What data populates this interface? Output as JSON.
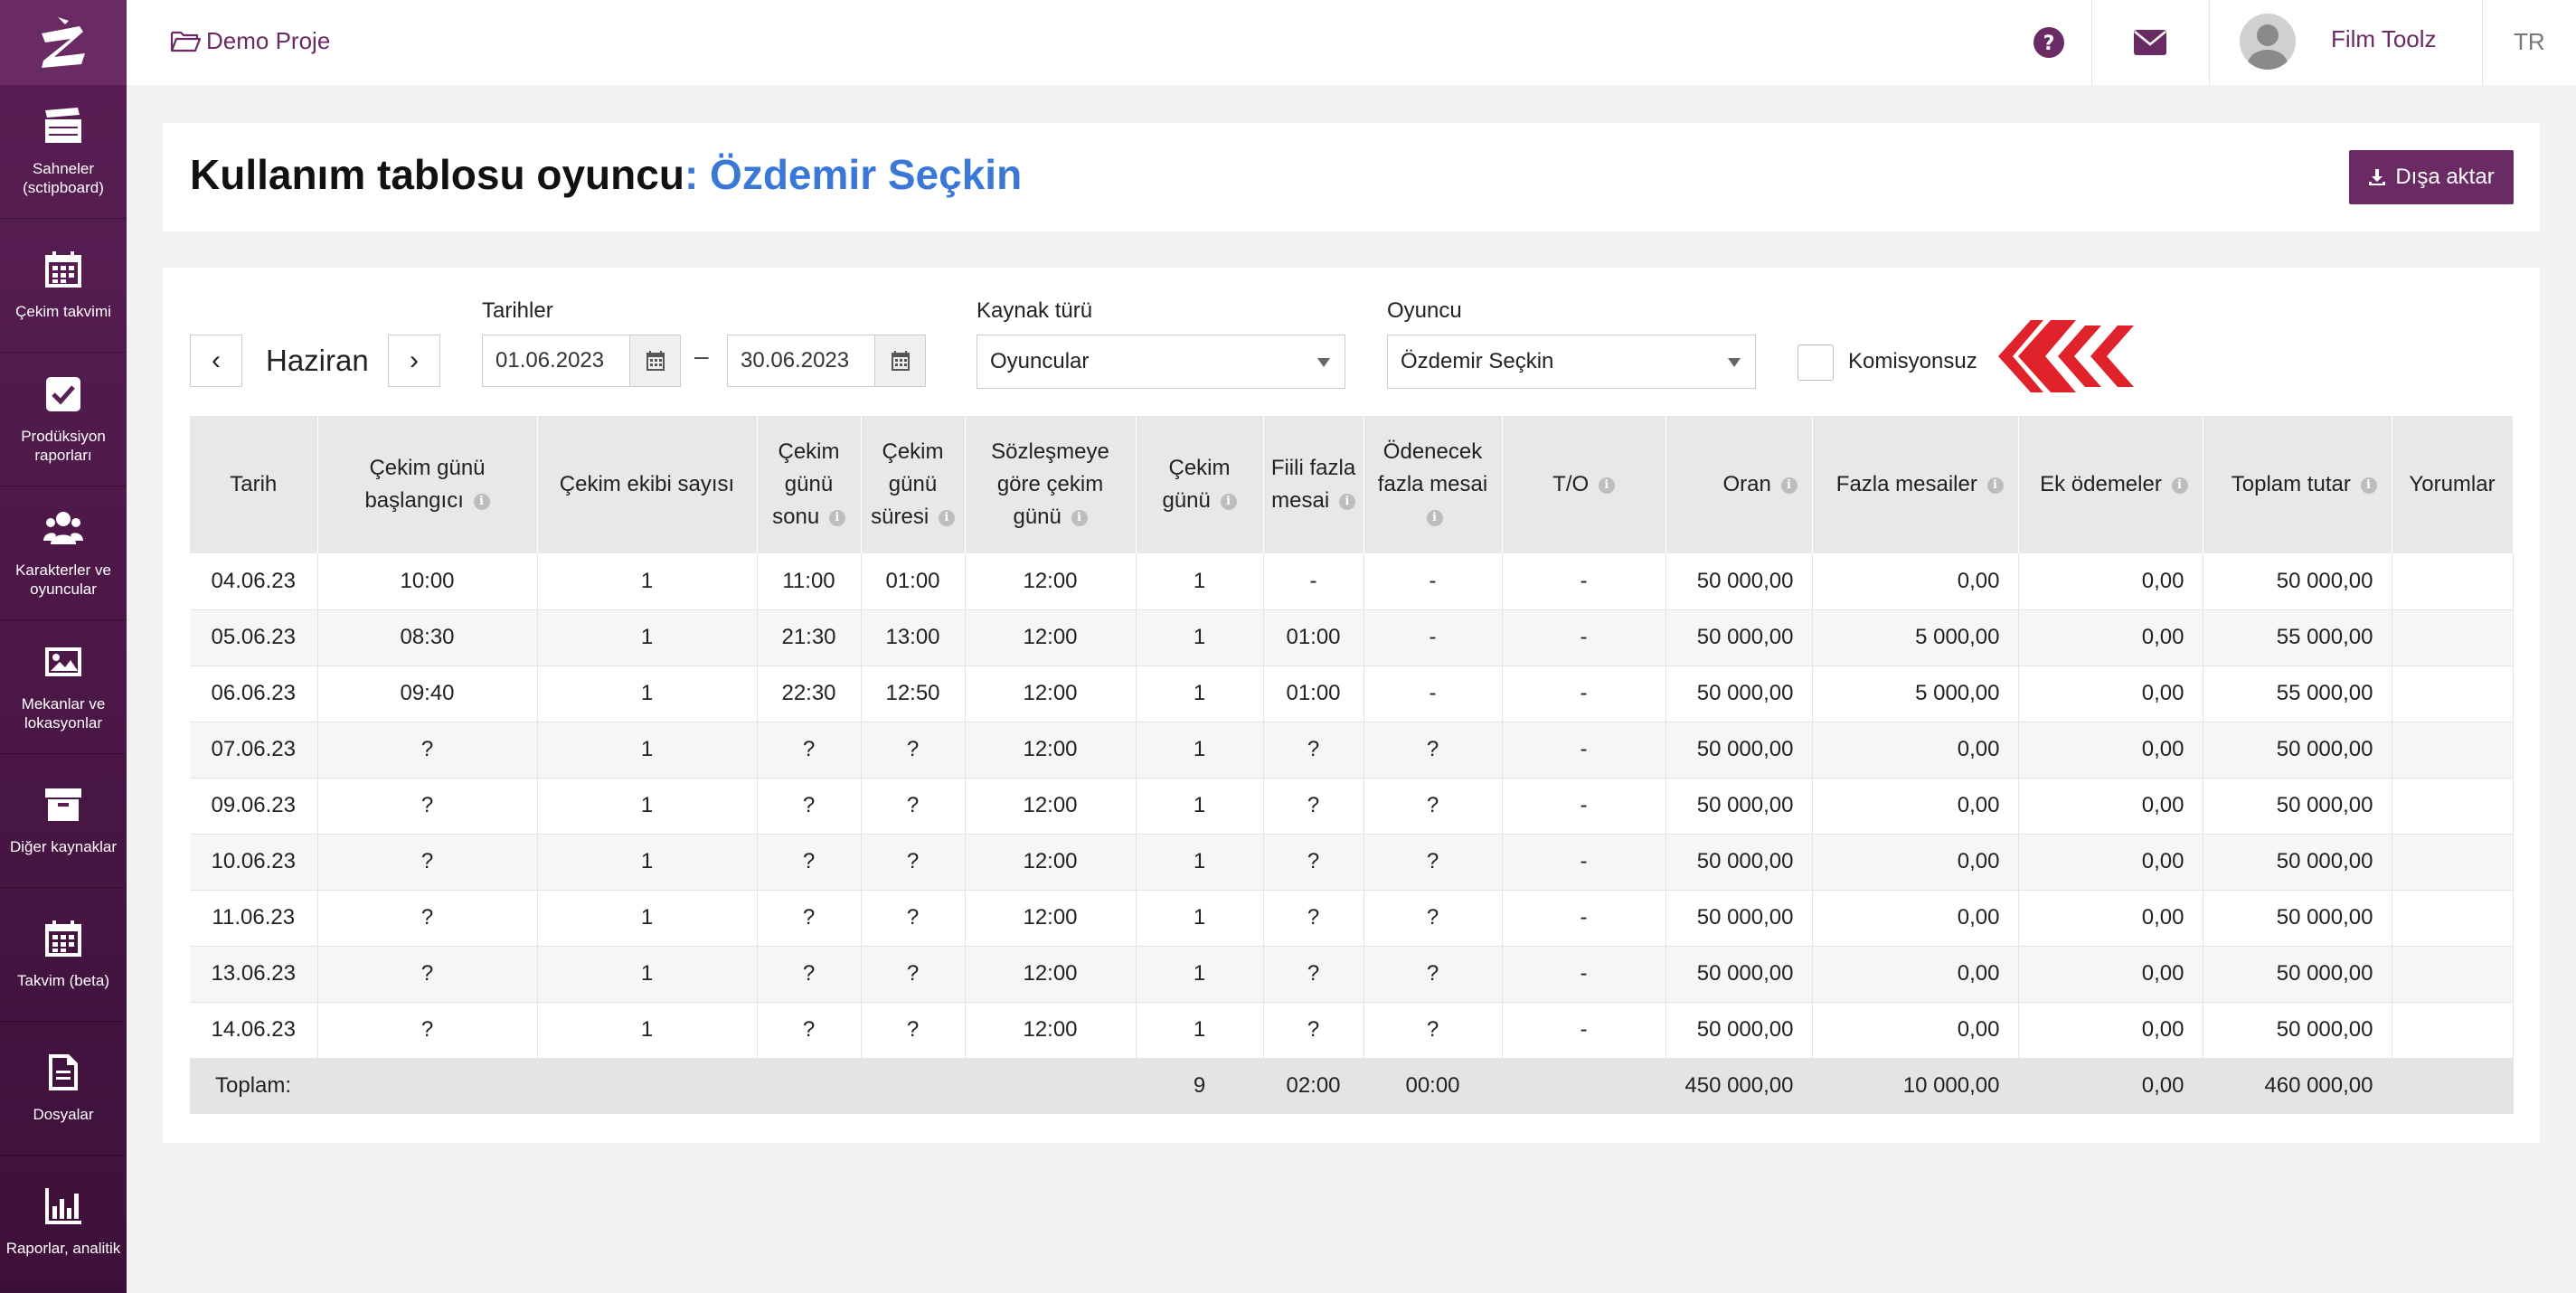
{
  "sidebar": {
    "items": [
      {
        "label": "Sahneler (sctipboard)",
        "icon": "clapperboard-icon"
      },
      {
        "label": "Çekim takvimi",
        "icon": "calendar-icon"
      },
      {
        "label": "Prodüksiyon raporları",
        "icon": "check-square-icon"
      },
      {
        "label": "Karakterler ve oyuncular",
        "icon": "users-icon"
      },
      {
        "label": "Mekanlar ve lokasyonlar",
        "icon": "image-icon"
      },
      {
        "label": "Diğer kaynaklar",
        "icon": "archive-icon"
      },
      {
        "label": "Takvim (beta)",
        "icon": "calendar-icon"
      },
      {
        "label": "Dosyalar",
        "icon": "file-icon"
      },
      {
        "label": "Raporlar, analitik",
        "icon": "bar-chart-icon"
      }
    ]
  },
  "header": {
    "project": "Demo Proje",
    "user": "Film Toolz",
    "lang": "TR"
  },
  "page": {
    "title_prefix": "Kullanım tablosu oyuncu",
    "colon": ":",
    "actor": "Özdemir Seçkin",
    "export_label": "Dışa aktar"
  },
  "filters": {
    "month": "Haziran",
    "prev": "‹",
    "next": "›",
    "dates_label": "Tarihler",
    "date_from": "01.06.2023",
    "date_sep": "–",
    "date_to": "30.06.2023",
    "resource_label": "Kaynak türü",
    "resource_value": "Oyuncular",
    "actor_label": "Oyuncu",
    "actor_value": "Özdemir Seçkin",
    "commission_label": "Komisyonsuz"
  },
  "table": {
    "headers": [
      "Tarih",
      "Çekim günü başlangıcı",
      "Çekim ekibi sayısı",
      "Çekim günü sonu",
      "Çekim günü süresi",
      "Sözleşmeye göre çekim günü",
      "Çekim günü",
      "Fiili fazla mesai",
      "Ödenecek fazla mesai",
      "T/O",
      "Oran",
      "Fazla mesailer",
      "Ek ödemeler",
      "Toplam tutar",
      "Yorumlar"
    ],
    "rows": [
      [
        "04.06.23",
        "10:00",
        "1",
        "11:00",
        "01:00",
        "12:00",
        "1",
        "-",
        "-",
        "-",
        "50 000,00",
        "0,00",
        "0,00",
        "50 000,00",
        ""
      ],
      [
        "05.06.23",
        "08:30",
        "1",
        "21:30",
        "13:00",
        "12:00",
        "1",
        "01:00",
        "-",
        "-",
        "50 000,00",
        "5 000,00",
        "0,00",
        "55 000,00",
        ""
      ],
      [
        "06.06.23",
        "09:40",
        "1",
        "22:30",
        "12:50",
        "12:00",
        "1",
        "01:00",
        "-",
        "-",
        "50 000,00",
        "5 000,00",
        "0,00",
        "55 000,00",
        ""
      ],
      [
        "07.06.23",
        "?",
        "1",
        "?",
        "?",
        "12:00",
        "1",
        "?",
        "?",
        "-",
        "50 000,00",
        "0,00",
        "0,00",
        "50 000,00",
        ""
      ],
      [
        "09.06.23",
        "?",
        "1",
        "?",
        "?",
        "12:00",
        "1",
        "?",
        "?",
        "-",
        "50 000,00",
        "0,00",
        "0,00",
        "50 000,00",
        ""
      ],
      [
        "10.06.23",
        "?",
        "1",
        "?",
        "?",
        "12:00",
        "1",
        "?",
        "?",
        "-",
        "50 000,00",
        "0,00",
        "0,00",
        "50 000,00",
        ""
      ],
      [
        "11.06.23",
        "?",
        "1",
        "?",
        "?",
        "12:00",
        "1",
        "?",
        "?",
        "-",
        "50 000,00",
        "0,00",
        "0,00",
        "50 000,00",
        ""
      ],
      [
        "13.06.23",
        "?",
        "1",
        "?",
        "?",
        "12:00",
        "1",
        "?",
        "?",
        "-",
        "50 000,00",
        "0,00",
        "0,00",
        "50 000,00",
        ""
      ],
      [
        "14.06.23",
        "?",
        "1",
        "?",
        "?",
        "12:00",
        "1",
        "?",
        "?",
        "-",
        "50 000,00",
        "0,00",
        "0,00",
        "50 000,00",
        ""
      ]
    ],
    "totals": {
      "label": "Toplam:",
      "shooting_days": "9",
      "actual_overtime": "02:00",
      "payable_overtime": "00:00",
      "rate": "450 000,00",
      "overtime": "10 000,00",
      "extra": "0,00",
      "total": "460 000,00"
    }
  },
  "colors": {
    "accent": "#6a2a64",
    "link": "#3a78d8",
    "chevrons": "#e0222a"
  }
}
